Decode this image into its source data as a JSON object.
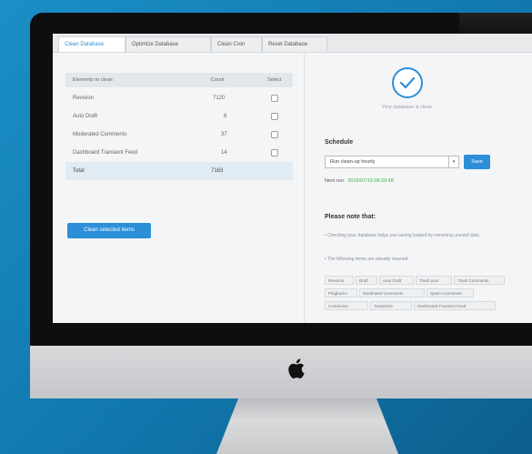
{
  "tabs": [
    {
      "label": "Clean Database",
      "active": true
    },
    {
      "label": "Optimize Database",
      "active": false
    },
    {
      "label": "Clean Cron",
      "active": false
    },
    {
      "label": "Reset Database",
      "active": false
    }
  ],
  "table": {
    "headers": [
      "Elements to clean",
      "Count",
      "Select"
    ],
    "rows": [
      {
        "name": "Revision",
        "count": "7120"
      },
      {
        "name": "Auto Draft",
        "count": "6"
      },
      {
        "name": "Moderated Comments",
        "count": "37"
      },
      {
        "name": "Dashboard Transient Feed",
        "count": "14"
      }
    ],
    "total_label": "Total",
    "total_value": "7163"
  },
  "clean_button": "Clean selected items",
  "status_text": "Your database is clean",
  "schedule": {
    "title": "Schedule",
    "selected": "Run clean-up hourly",
    "save": "Save",
    "next_run_label": "Next run:",
    "next_run_value": "2015/07/19 08:29:48"
  },
  "note": {
    "title": "Please note that:",
    "bullets": [
      "Checking your database helps you saving loaded by removing unused data.",
      "The following items are already cleaned:"
    ],
    "chips": [
      "Revision",
      "Draft",
      "Auto Draft",
      "Trash post",
      "Trash Comments",
      "Pingbacks",
      "Moderated Comments",
      "Spam Comments",
      "Comments",
      "Transients",
      "Dashboard Transient Feed"
    ]
  },
  "colors": {
    "accent": "#2c8fd8",
    "success": "#3bb04b",
    "background": "#1a8fc6"
  }
}
